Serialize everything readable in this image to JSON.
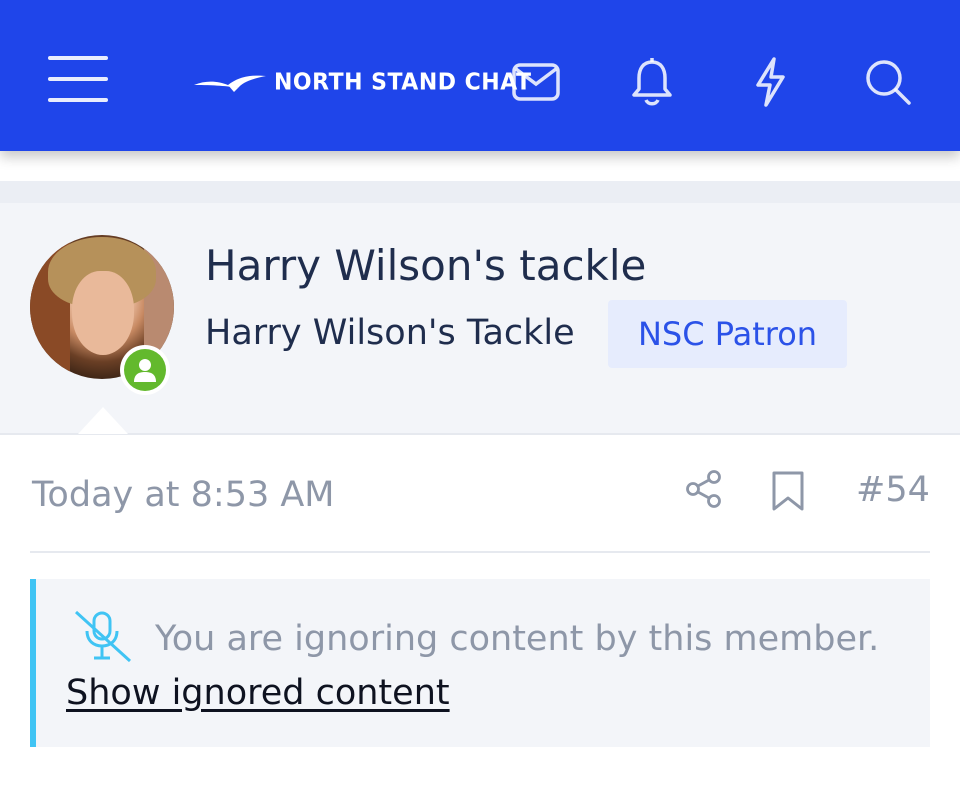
{
  "header": {
    "logo_text": "NORTH STAND CHAT",
    "icons": [
      "menu-icon",
      "envelope-icon",
      "bell-icon",
      "lightning-icon",
      "search-icon"
    ],
    "brand_color": "#1f45ea"
  },
  "post": {
    "username": "Harry Wilson's tackle",
    "user_title": "Harry Wilson's Tackle",
    "user_banner": "NSC Patron",
    "date": "Today at 8:53 AM",
    "post_number": "#54",
    "ignored_message": "You are ignoring content by this member.",
    "show_ignored_label": "Show ignored content",
    "online_status_color": "#63b92d"
  }
}
